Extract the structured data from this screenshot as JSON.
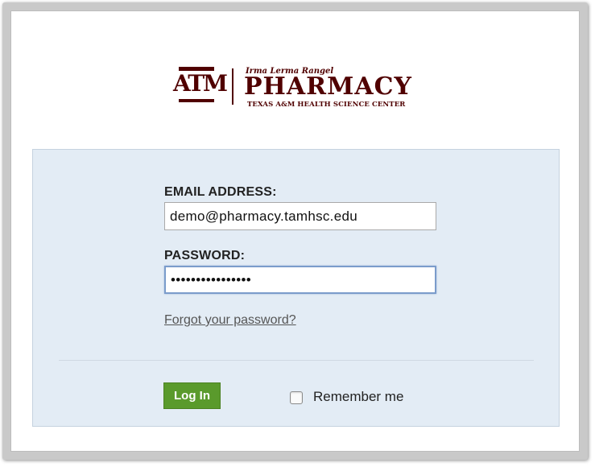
{
  "logo": {
    "emblem": "ATM",
    "emblem_name": "texas-am-emblem",
    "script_line": "Irma Lerma Rangel",
    "title": "PHARMACY",
    "subtitle": "TEXAS A&M HEALTH SCIENCE CENTER",
    "brand_color": "#500000"
  },
  "form": {
    "email_label": "EMAIL ADDRESS:",
    "email_value": "demo@pharmacy.tamhsc.edu",
    "password_label": "PASSWORD:",
    "password_value": "••••••••••••••••",
    "forgot_link": "Forgot your password?",
    "login_button": "Log In",
    "remember_label": "Remember me",
    "remember_checked": false,
    "button_color": "#5a9a2c",
    "panel_color": "#e3ecf5"
  }
}
